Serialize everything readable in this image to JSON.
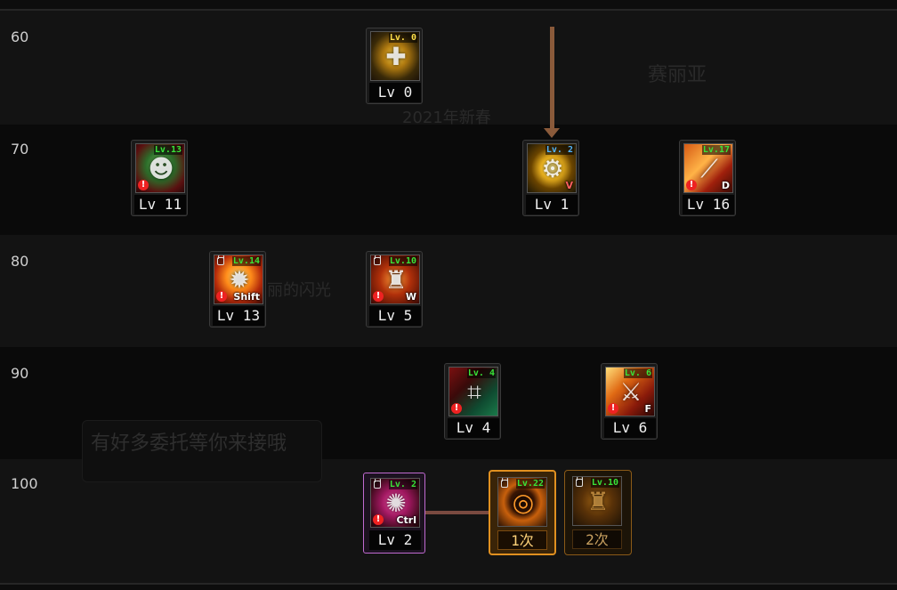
{
  "rows": [
    {
      "level": "60"
    },
    {
      "level": "70"
    },
    {
      "level": "80"
    },
    {
      "level": "90"
    },
    {
      "level": "100"
    }
  ],
  "background_text": {
    "banner_top": "2021年新春",
    "name": "赛丽亚",
    "bubble": "有好多委托等你来接哦",
    "mid": "丽的闪光"
  },
  "skills": {
    "s60": {
      "badge": "Lv. 0",
      "label": "Lv 0",
      "icon": "golden-cross-icon"
    },
    "s70a": {
      "badge": "Lv.13",
      "label": "Lv 11",
      "icon": "green-mask-icon"
    },
    "s70b": {
      "badge": "Lv. 2",
      "label": "Lv 1",
      "hotkey": "V",
      "icon": "gear-icon"
    },
    "s70c": {
      "badge": "Lv.17",
      "label": "Lv 16",
      "hotkey": "D",
      "icon": "cannon-icon"
    },
    "s80a": {
      "badge": "Lv.14",
      "label": "Lv 13",
      "hotkey": "Shift",
      "icon": "explosion-icon"
    },
    "s80b": {
      "badge": "Lv.10",
      "label": "Lv 5",
      "hotkey": "W",
      "icon": "flame-mech-icon"
    },
    "s90a": {
      "badge": "Lv. 4",
      "label": "Lv 4",
      "icon": "circuit-icon"
    },
    "s90b": {
      "badge": "Lv. 6",
      "label": "Lv 6",
      "hotkey": "F",
      "icon": "blade-icon"
    },
    "s100a": {
      "badge": "Lv. 2",
      "label": "Lv 2",
      "hotkey": "Ctrl",
      "icon": "magenta-burst-icon"
    },
    "s100b": {
      "badge": "Lv.22",
      "label": "1次",
      "icon": "awakening-ring-icon"
    },
    "s100c": {
      "badge": "Lv.10",
      "label": "2次",
      "icon": "dark-mech-icon"
    }
  }
}
